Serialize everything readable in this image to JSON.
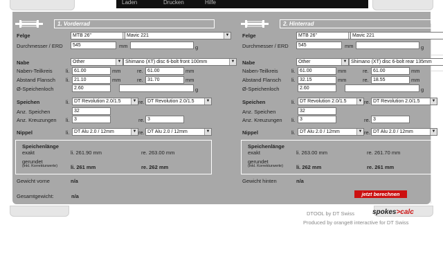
{
  "topnav": [
    "Laden",
    "Drucken",
    "Hilfe"
  ],
  "front": {
    "title": "1. Vorderrad",
    "felge_label": "Felge",
    "rim_size": "MTB 26\"",
    "rim_model": "Mavic 221",
    "erd_label": "Durchmesser / ERD",
    "erd_value": "545",
    "erd_unit": "mm",
    "rim_weight_unit": "g",
    "nabe_label": "Nabe",
    "hub_brand": "Other",
    "hub_model": "Shimano (XT) disc 6-bolt front 100mm",
    "flange_label": "Naben-Teilkreis",
    "li": "li.",
    "re": "re.",
    "mm": "mm",
    "g": "g",
    "flange_li": "61.00",
    "flange_re": "61.00",
    "dist_label": "Abstand Flansch",
    "dist_li": "21.10",
    "dist_re": "31.70",
    "hole_label": "Ø-Speichenloch",
    "hole_value": "2.60",
    "speichen_label": "Speichen",
    "spoke_li": "DT Revolution 2.0/1.5",
    "spoke_re": "DT Revolution 2.0/1.5",
    "count_label": "Anz. Speichen",
    "count_value": "32",
    "cross_label": "Anz. Kreuzungen",
    "cross_li": "3",
    "cross_re": "3",
    "nippel_label": "Nippel",
    "nip_li": "DT Alu 2.0 / 12mm",
    "nip_re": "DT Alu 2.0 / 12mm",
    "len_title": "Speichenlänge",
    "exakt_label": "exakt",
    "exakt_li": "li. 261.90 mm",
    "exakt_re": "re. 263.00 mm",
    "gerundet_label": "gerundet",
    "korrektur_label": "(inkl. Korrekturwerte)",
    "round_li": "li. 261 mm",
    "round_re": "re. 262 mm",
    "weight_label": "Gewicht vorne",
    "weight_value": "n/a"
  },
  "rear": {
    "title": "2. Hinterrad",
    "felge_label": "Felge",
    "rim_size": "MTB 26\"",
    "rim_model": "Mavic 221",
    "erd_label": "Durchmesser / ERD",
    "erd_value": "545",
    "erd_unit": "mm",
    "rim_weight_unit": "g",
    "nabe_label": "Nabe",
    "hub_brand": "Other",
    "hub_model": "Shimano (XT) disc 6-bolt rear 135mm",
    "flange_label": "Naben-Teilkreis",
    "li": "li.",
    "re": "re.",
    "mm": "mm",
    "g": "g",
    "flange_li": "61.00",
    "flange_re": "61.00",
    "dist_label": "Abstand Flansch",
    "dist_li": "32.15",
    "dist_re": "18.55",
    "hole_label": "Ø-Speichenloch",
    "hole_value": "2.60",
    "speichen_label": "Speichen",
    "spoke_li": "DT Revolution 2.0/1.5",
    "spoke_re": "DT Revolution 2.0/1.5",
    "count_label": "Anz. Speichen",
    "count_value": "32",
    "cross_label": "Anz. Kreuzungen",
    "cross_li": "3",
    "cross_re": "3",
    "nippel_label": "Nippel",
    "nip_li": "DT Alu 2.0 / 12mm",
    "nip_re": "DT Alu 2.0 / 12mm",
    "len_title": "Speichenlänge",
    "exakt_label": "exakt",
    "exakt_li": "li. 263.00 mm",
    "exakt_re": "re. 261.70 mm",
    "gerundet_label": "gerundet",
    "korrektur_label": "(inkl. Korrekturwerte)",
    "round_li": "li. 262 mm",
    "round_re": "re. 261 mm",
    "weight_label": "Gewicht hinten",
    "weight_value": "n/a"
  },
  "total_label": "Gesamtgewicht:",
  "total_value": "n/a",
  "calc_button": "jetzt berechnen",
  "footer": {
    "dtool": "DTOOL by DT Swiss",
    "logo_a": "spokes",
    "logo_b": ">calc",
    "produced": "Produced by orange8 interactive for DT Swiss"
  },
  "colors": {
    "panel": "#a8a8a8",
    "accent": "#cc1111"
  }
}
